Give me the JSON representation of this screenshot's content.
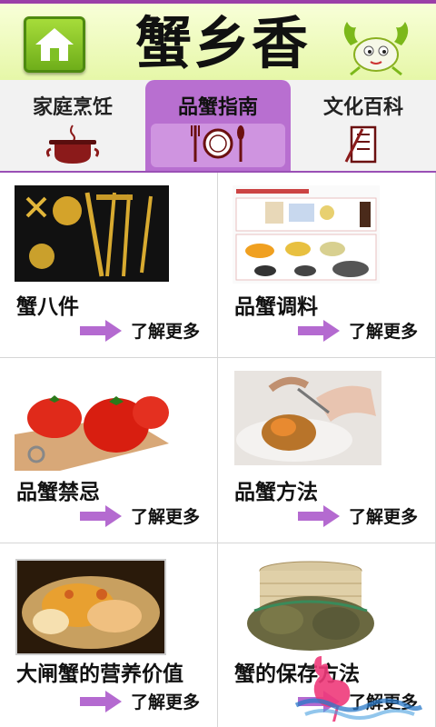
{
  "header": {
    "title": "蟹乡香",
    "home_icon": "home-icon",
    "mascot_icon": "crab-mascot-icon"
  },
  "tabs": [
    {
      "label": "家庭烹饪",
      "icon": "cooking-pot-icon",
      "active": false
    },
    {
      "label": "品蟹指南",
      "icon": "cutlery-plate-icon",
      "active": true
    },
    {
      "label": "文化百科",
      "icon": "book-icon",
      "active": false
    }
  ],
  "cards": [
    {
      "title": "蟹八件",
      "more": "了解更多",
      "image": "crab-tools-photo"
    },
    {
      "title": "品蟹调料",
      "more": "了解更多",
      "image": "seasonings-photo"
    },
    {
      "title": "品蟹禁忌",
      "more": "了解更多",
      "image": "tomatoes-photo"
    },
    {
      "title": "品蟹方法",
      "more": "了解更多",
      "image": "eating-crab-photo"
    },
    {
      "title": "大闸蟹的营养价值",
      "more": "了解更多",
      "image": "crab-dish-photo"
    },
    {
      "title": "蟹的保存方法",
      "more": "了解更多",
      "image": "crab-basket-photo"
    }
  ],
  "colors": {
    "accent": "#b86fd0",
    "arrow": "#b46ad0",
    "header_bg": "#e6f7a8",
    "home_green": "#7fc025"
  }
}
